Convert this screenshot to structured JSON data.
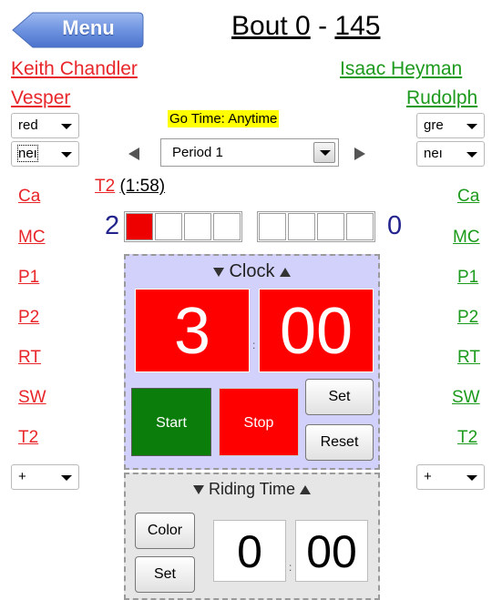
{
  "header": {
    "menu_label": "Menu",
    "bout_label": "Bout 0",
    "separator": " - ",
    "bout_number": "145"
  },
  "wrestlers": {
    "left": {
      "name": "Keith Chandler",
      "team": "Vesper",
      "color": "#e8262a"
    },
    "right": {
      "name": "Isaac Heyman",
      "team": "Rudolph",
      "color": "#1c9a1c"
    }
  },
  "selects": {
    "left_color": "red",
    "left_position": "neı",
    "right_color": "gre",
    "right_position": "neı",
    "left_add": "+",
    "right_add": "+"
  },
  "period": {
    "go_time": "Go Time: Anytime",
    "selected": "Period 1"
  },
  "timeout": {
    "code": "T2",
    "time": "(1:58)"
  },
  "score": {
    "left": "2",
    "right": "0",
    "left_boxes_filled": 1,
    "right_boxes_filled": 0
  },
  "moves": {
    "left": [
      "Ca",
      "MC",
      "P1",
      "P2",
      "RT",
      "SW",
      "T2"
    ],
    "right": [
      "Ca",
      "MC",
      "P1",
      "P2",
      "RT",
      "SW",
      "T2"
    ]
  },
  "clock": {
    "title": "Clock",
    "minutes": "3",
    "seconds": "00",
    "colon": ":",
    "start_label": "Start",
    "stop_label": "Stop",
    "set_label": "Set",
    "reset_label": "Reset"
  },
  "riding_time": {
    "title": "Riding Time",
    "minutes": "0",
    "seconds": "00",
    "colon": ":",
    "color_label": "Color",
    "set_label": "Set"
  },
  "colors": {
    "red": "#e8262a",
    "green": "#1c9a1c",
    "clock_bg": "#ff0000",
    "start_bg": "#0b7d0b",
    "panel_bg": "#d1d1fc",
    "go_time_highlight": "#ffff00"
  }
}
